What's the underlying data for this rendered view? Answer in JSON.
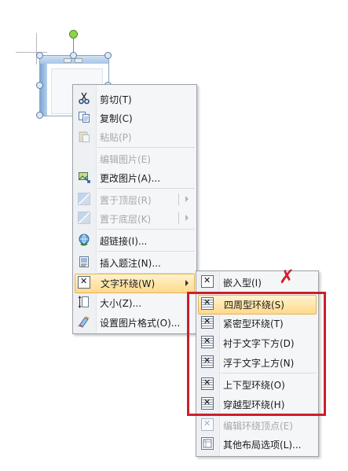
{
  "context_menu": {
    "items": [
      {
        "label": "剪切(T)",
        "icon": "scissors-icon",
        "enabled": true
      },
      {
        "label": "复制(C)",
        "icon": "copy-icon",
        "enabled": true
      },
      {
        "label": "粘贴(P)",
        "icon": "paste-icon",
        "enabled": false
      },
      {
        "label": "编辑图片(E)",
        "icon": "",
        "enabled": false
      },
      {
        "label": "更改图片(A)...",
        "icon": "change-picture-icon",
        "enabled": true
      },
      {
        "label": "置于顶层(R)",
        "icon": "bring-to-front-icon",
        "enabled": false,
        "submenu": true
      },
      {
        "label": "置于底层(K)",
        "icon": "send-to-back-icon",
        "enabled": false,
        "submenu": true
      },
      {
        "label": "超链接(I)...",
        "icon": "hyperlink-icon",
        "enabled": true
      },
      {
        "label": "插入题注(N)...",
        "icon": "caption-icon",
        "enabled": true
      },
      {
        "label": "文字环绕(W)",
        "icon": "text-wrap-icon",
        "enabled": true,
        "submenu": true,
        "highlighted": true
      },
      {
        "label": "大小(Z)...",
        "icon": "size-icon",
        "enabled": true
      },
      {
        "label": "设置图片格式(O)...",
        "icon": "format-picture-icon",
        "enabled": true
      }
    ]
  },
  "wrap_submenu": {
    "items": [
      {
        "label": "嵌入型(I)",
        "icon": "inline-wrap-icon",
        "enabled": true
      },
      {
        "label": "四周型环绕(S)",
        "icon": "square-wrap-icon",
        "enabled": true,
        "highlighted": true
      },
      {
        "label": "紧密型环绕(T)",
        "icon": "tight-wrap-icon",
        "enabled": true
      },
      {
        "label": "衬于文字下方(D)",
        "icon": "behind-text-icon",
        "enabled": true
      },
      {
        "label": "浮于文字上方(N)",
        "icon": "in-front-of-text-icon",
        "enabled": true
      },
      {
        "label": "上下型环绕(O)",
        "icon": "top-bottom-wrap-icon",
        "enabled": true
      },
      {
        "label": "穿越型环绕(H)",
        "icon": "through-wrap-icon",
        "enabled": true
      },
      {
        "label": "编辑环绕顶点(E)",
        "icon": "edit-wrap-points-icon",
        "enabled": false
      },
      {
        "label": "其他布局选项(L)...",
        "icon": "more-layout-icon",
        "enabled": true
      }
    ]
  },
  "annotation": {
    "mark": "✗",
    "highlight_color": "#cc1f2b"
  },
  "colors": {
    "menu_bg": "#f5f6f8",
    "hover_bg": "#ffd98a",
    "disabled_text": "#a8a8a8"
  }
}
